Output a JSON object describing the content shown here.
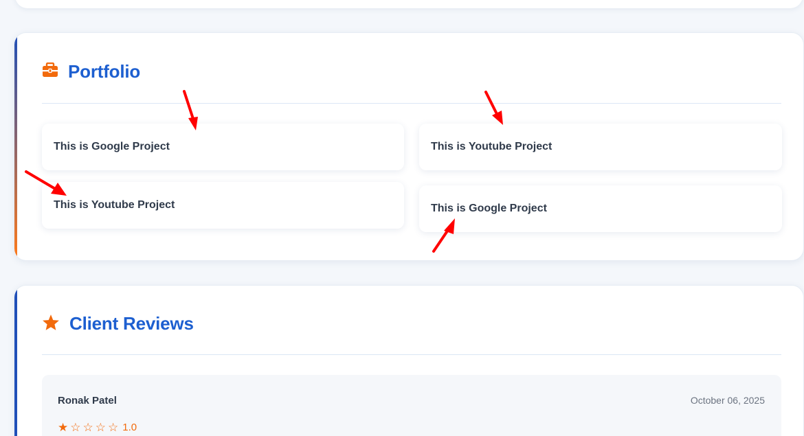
{
  "portfolio": {
    "title": "Portfolio",
    "icon": "briefcase-icon",
    "projects": [
      {
        "label": "This is Google Project"
      },
      {
        "label": "This is Youtube Project"
      },
      {
        "label": "This is Youtube Project"
      },
      {
        "label": "This is Google Project"
      }
    ]
  },
  "reviews": {
    "title": "Client Reviews",
    "icon": "star-icon",
    "items": [
      {
        "name": "Ronak Patel",
        "date": "October 06, 2025",
        "rating": 1,
        "rating_label": "1.0",
        "max": 5
      }
    ]
  },
  "colors": {
    "accent": "#1d5fd0",
    "orange": "#f26a0c",
    "arrow": "#ff0000"
  }
}
